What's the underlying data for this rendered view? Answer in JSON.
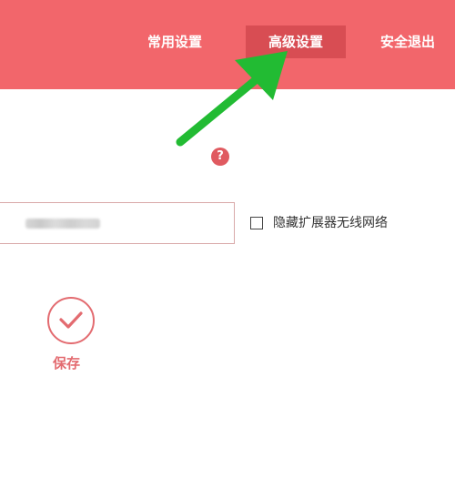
{
  "header": {
    "nav": {
      "common_settings": "常用设置",
      "advanced_settings": "高级设置",
      "logout": "安全退出"
    },
    "active_tab": "advanced_settings",
    "background_color": "#f2666b",
    "active_tab_color": "#d84d53"
  },
  "help": {
    "symbol": "?"
  },
  "form": {
    "hide_extender_ssid_label": "隐藏扩展器无线网络",
    "hide_extender_ssid_checked": false
  },
  "save": {
    "label": "保存",
    "icon": "checkmark-icon"
  },
  "annotation": {
    "icon": "green-arrow-pointer",
    "color": "#22bb33"
  },
  "accent_color": "#e36b70"
}
